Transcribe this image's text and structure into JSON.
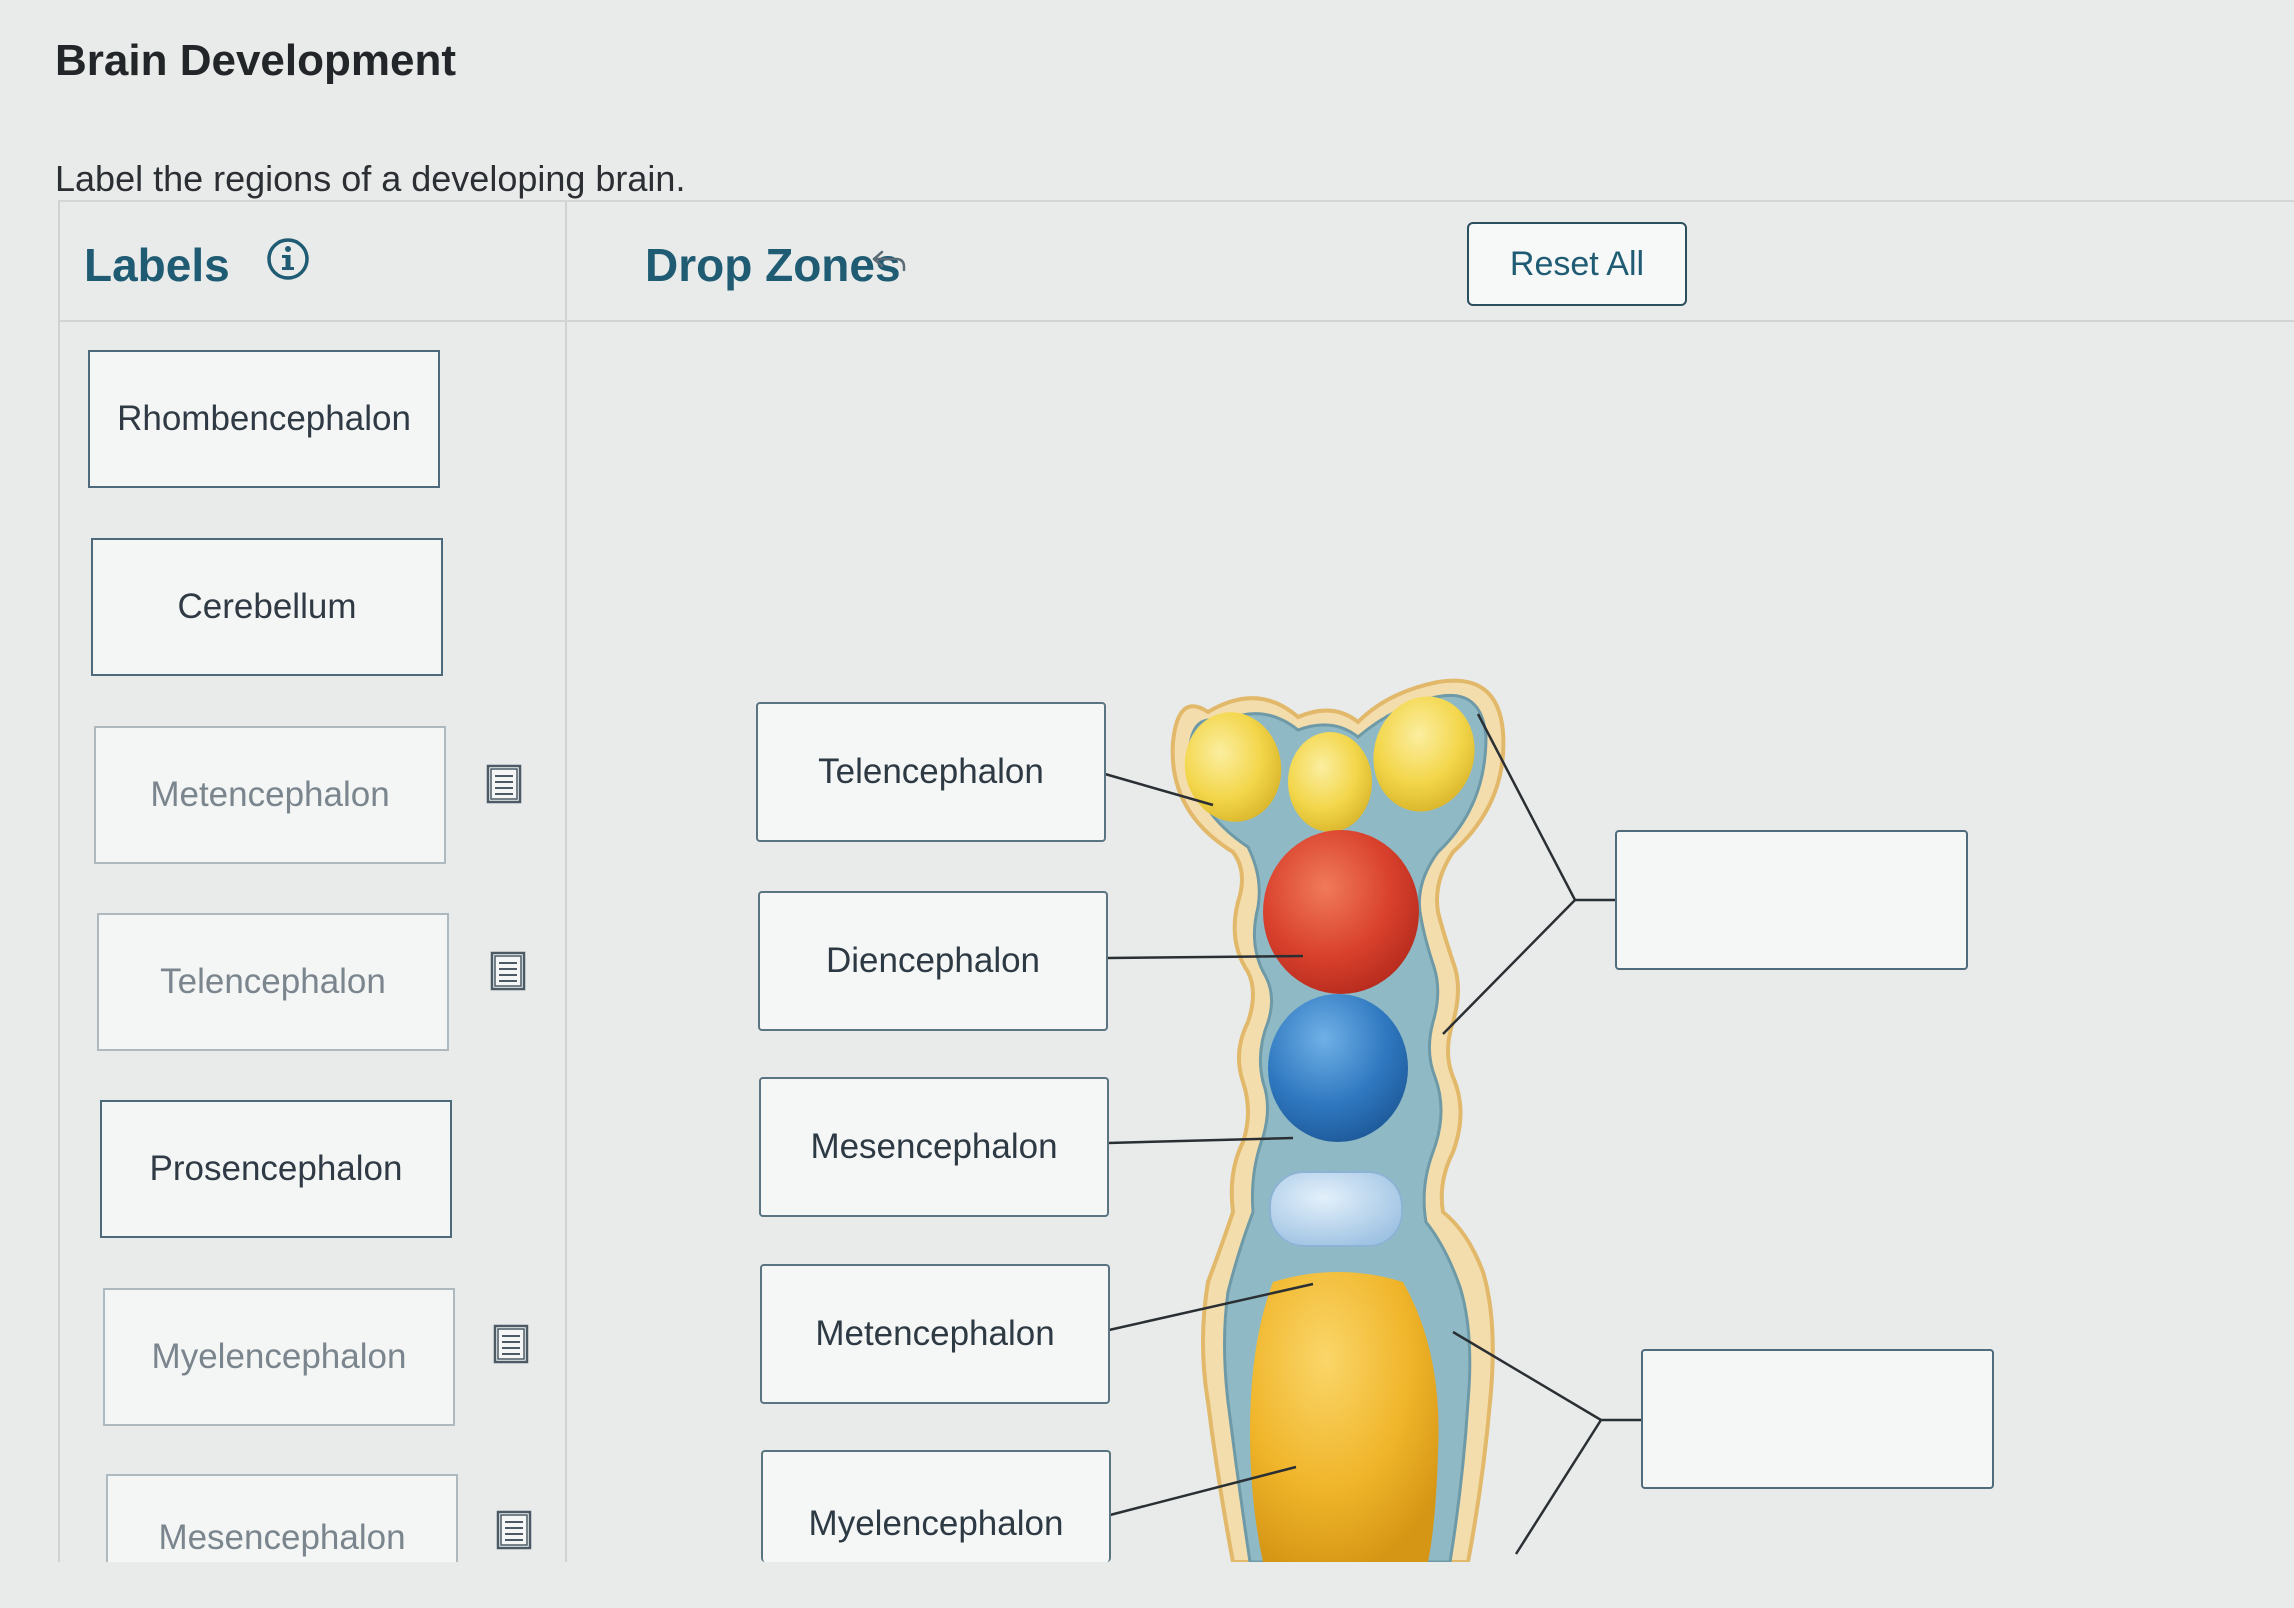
{
  "page": {
    "title": "Brain Development",
    "instructions": "Label the regions of a developing brain."
  },
  "labels_panel": {
    "title": "Labels",
    "cards": [
      {
        "text": "Rhombencephalon",
        "state": "available"
      },
      {
        "text": "Cerebellum",
        "state": "available"
      },
      {
        "text": "Metencephalon",
        "state": "used"
      },
      {
        "text": "Telencephalon",
        "state": "used"
      },
      {
        "text": "Prosencephalon",
        "state": "available"
      },
      {
        "text": "Myelencephalon",
        "state": "used"
      },
      {
        "text": "Mesencephalon",
        "state": "used"
      }
    ]
  },
  "drop_zones": {
    "title": "Drop Zones",
    "reset_label": "Reset All",
    "placed": [
      "Telencephalon",
      "Diencephalon",
      "Mesencephalon",
      "Metencephalon",
      "Myelencephalon"
    ],
    "empty_zones": 2
  },
  "colors": {
    "heading_teal": "#1f5b73",
    "telencephalon_yellow": "#f3d64a",
    "diencephalon_red": "#d9412c",
    "mesencephalon_blue": "#2f78c0",
    "metencephalon_lightblue": "#a9cbe8",
    "myelencephalon_gold": "#f0b52a"
  }
}
